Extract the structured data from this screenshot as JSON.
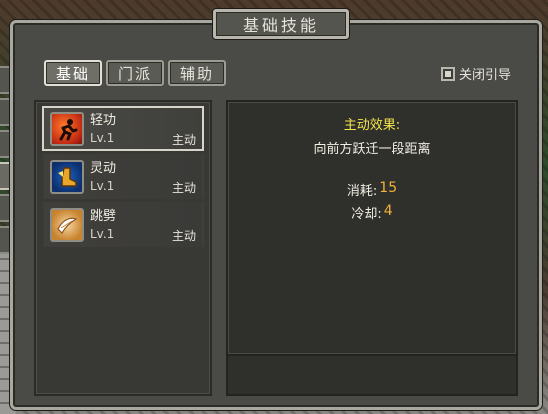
{
  "window": {
    "title": "基础技能"
  },
  "tabs": [
    {
      "label": "基础",
      "active": true
    },
    {
      "label": "门派",
      "active": false
    },
    {
      "label": "辅助",
      "active": false
    }
  ],
  "guide": {
    "label": "关闭引导"
  },
  "skills": [
    {
      "name": "轻功",
      "level": "Lv.1",
      "type": "主动",
      "icon": "running-figure-icon",
      "selected": true
    },
    {
      "name": "灵动",
      "level": "Lv.1",
      "type": "主动",
      "icon": "winged-boot-icon",
      "selected": false
    },
    {
      "name": "跳劈",
      "level": "Lv.1",
      "type": "主动",
      "icon": "slash-wing-icon",
      "selected": false
    }
  ],
  "detail": {
    "effect_title": "主动效果:",
    "effect_text": "向前方跃迁一段距离",
    "cost_label": "消耗:",
    "cost_value": "15",
    "cooldown_label": "冷却:",
    "cooldown_value": "4"
  },
  "colors": {
    "accent_yellow": "#f3e54a",
    "value_orange": "#f2b137"
  }
}
